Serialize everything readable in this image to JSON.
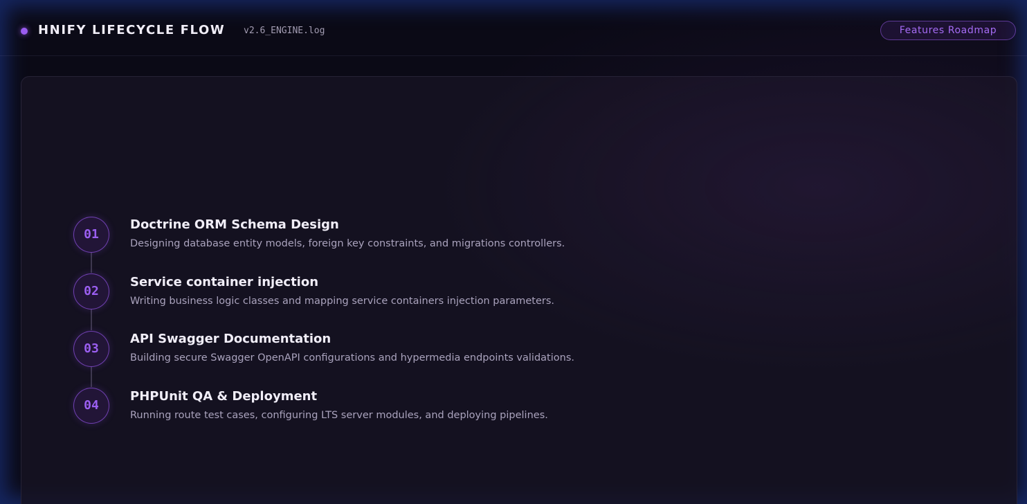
{
  "header": {
    "title": "HNIFY LIFECYCLE FLOW",
    "version": "v2.6_ENGINE.log",
    "roadmap_button": "Features Roadmap"
  },
  "steps": [
    {
      "number": "01",
      "title": "Doctrine ORM Schema Design",
      "description": "Designing database entity models, foreign key constraints, and migrations controllers."
    },
    {
      "number": "02",
      "title": "Service container injection",
      "description": "Writing business logic classes and mapping service containers injection parameters."
    },
    {
      "number": "03",
      "title": "API Swagger Documentation",
      "description": "Building secure Swagger OpenAPI configurations and hypermedia endpoints validations."
    },
    {
      "number": "04",
      "title": "PHPUnit QA & Deployment",
      "description": "Running route test cases, configuring LTS server modules, and deploying pipelines."
    }
  ],
  "colors": {
    "accent": "#9b5ff1",
    "background": "#0b0a16",
    "frame_glow": "#182c6e"
  }
}
